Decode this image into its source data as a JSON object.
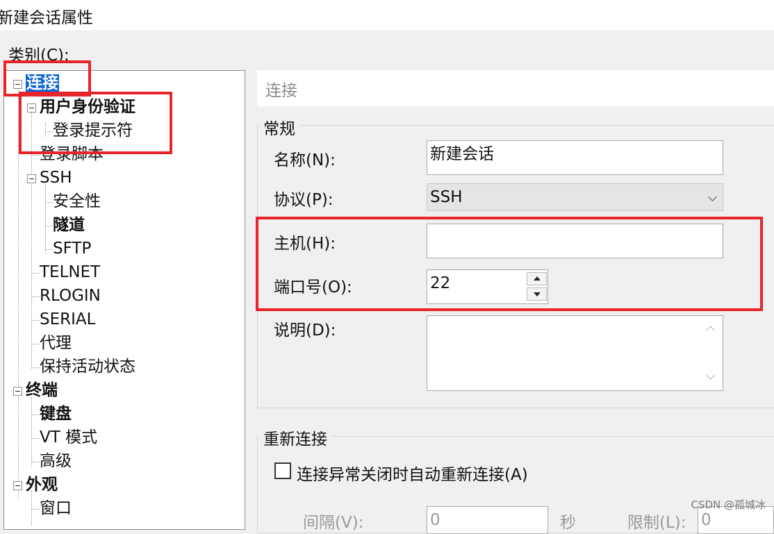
{
  "window": {
    "title": "新建会话属性"
  },
  "category_label": "类别(C):",
  "tree": {
    "connection": "连接",
    "auth": "用户身份验证",
    "login_prompt": "登录提示符",
    "login_script": "登录脚本",
    "ssh": "SSH",
    "security": "安全性",
    "tunnel": "隧道",
    "sftp": "SFTP",
    "telnet": "TELNET",
    "rlogin": "RLOGIN",
    "serial": "SERIAL",
    "proxy": "代理",
    "keepalive": "保持活动状态",
    "terminal": "终端",
    "keyboard": "键盘",
    "vt_mode": "VT 模式",
    "advanced": "高级",
    "appearance": "外观",
    "window": "窗口"
  },
  "panel": {
    "header": "连接",
    "general": {
      "title": "常规",
      "name_label": "名称(N):",
      "name_value": "新建会话",
      "protocol_label": "协议(P):",
      "protocol_value": "SSH",
      "host_label": "主机(H):",
      "host_value": "",
      "port_label": "端口号(O):",
      "port_value": "22",
      "desc_label": "说明(D):",
      "desc_value": ""
    },
    "reconnect": {
      "title": "重新连接",
      "auto_label": "连接异常关闭时自动重新连接(A)",
      "auto_checked": false,
      "interval_label": "间隔(V):",
      "interval_value": "0",
      "seconds_label": "秒",
      "limit_label": "限制(L):",
      "limit_value": "0"
    }
  },
  "watermark": "CSDN @孤城冰",
  "colors": {
    "selection": "#0a64d2",
    "annotation": "#e8242b"
  }
}
